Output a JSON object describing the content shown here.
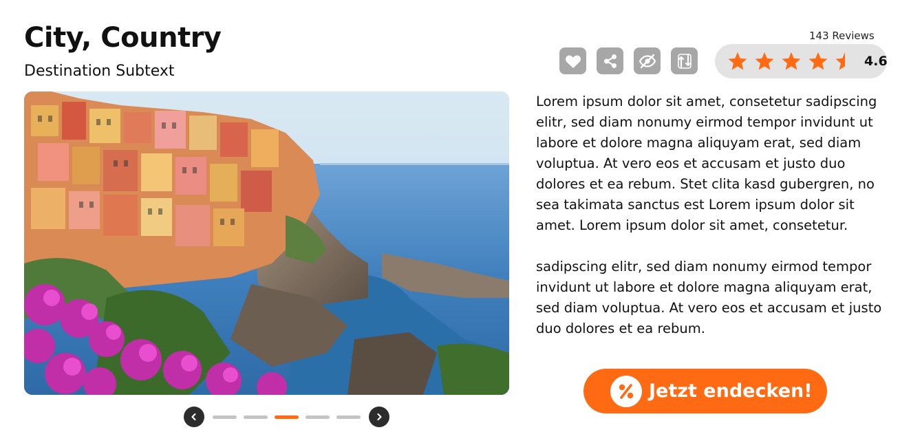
{
  "header": {
    "title": "City, Country",
    "subtitle": "Destination Subtext"
  },
  "gallery": {
    "image_alt": "Colorful cliffside village above the sea with pink flowers",
    "slide_count": 5,
    "active_slide": 3
  },
  "actions": [
    {
      "name": "favorite",
      "icon": "heart-icon"
    },
    {
      "name": "share",
      "icon": "share-icon"
    },
    {
      "name": "hide",
      "icon": "eye-off-icon"
    },
    {
      "name": "compare",
      "icon": "swap-icon"
    }
  ],
  "rating": {
    "reviews_label": "143 Reviews",
    "value": "4.6",
    "stars": 4.6,
    "max_stars": 5
  },
  "description": {
    "paragraph_1": "Lorem ipsum dolor sit amet, consetetur sadipscing elitr, sed diam nonumy eirmod tempor invidunt ut labore et dolore magna aliquyam erat, sed diam voluptua. At vero eos et accusam et justo duo dolores et ea rebum. Stet clita kasd gubergren, no sea takimata sanctus est Lorem ipsum dolor sit amet. Lorem ipsum dolor sit amet, consetetur.",
    "paragraph_2": "sadipscing elitr, sed diam nonumy eirmod tempor invidunt ut labore et dolore magna aliquyam erat, sed diam voluptua. At vero eos et accusam et justo duo dolores et ea rebum."
  },
  "cta": {
    "label": "Jetzt endecken!",
    "icon": "percent-icon"
  },
  "colors": {
    "accent": "#ff6a13",
    "icon_button": "#a7a7a7",
    "rating_bg": "#e3e3e3",
    "dark_nav": "#2c2c2c"
  }
}
